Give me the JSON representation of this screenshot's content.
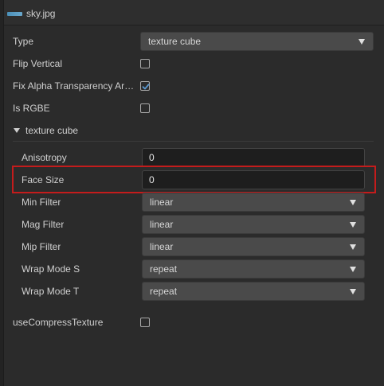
{
  "header": {
    "title": "sky.jpg",
    "icon": "image-file-icon"
  },
  "properties": {
    "type": {
      "label": "Type",
      "value": "texture cube"
    },
    "flip_vertical": {
      "label": "Flip Vertical",
      "checked": false
    },
    "fix_alpha": {
      "label": "Fix Alpha Transparency Ar…",
      "checked": true
    },
    "is_rgbe": {
      "label": "Is RGBE",
      "checked": false
    }
  },
  "section": {
    "title": "texture cube",
    "expanded": true,
    "anisotropy": {
      "label": "Anisotropy",
      "value": "0"
    },
    "face_size": {
      "label": "Face Size",
      "value": "0"
    },
    "min_filter": {
      "label": "Min Filter",
      "value": "linear"
    },
    "mag_filter": {
      "label": "Mag Filter",
      "value": "linear"
    },
    "mip_filter": {
      "label": "Mip Filter",
      "value": "linear"
    },
    "wrap_mode_s": {
      "label": "Wrap Mode S",
      "value": "repeat"
    },
    "wrap_mode_t": {
      "label": "Wrap Mode T",
      "value": "repeat"
    }
  },
  "footer": {
    "use_compress": {
      "label": "useCompressTexture",
      "checked": false
    }
  },
  "colors": {
    "accent_check": "#5b9bd5",
    "highlight": "#c41c1c",
    "background": "#2b2b2b"
  }
}
